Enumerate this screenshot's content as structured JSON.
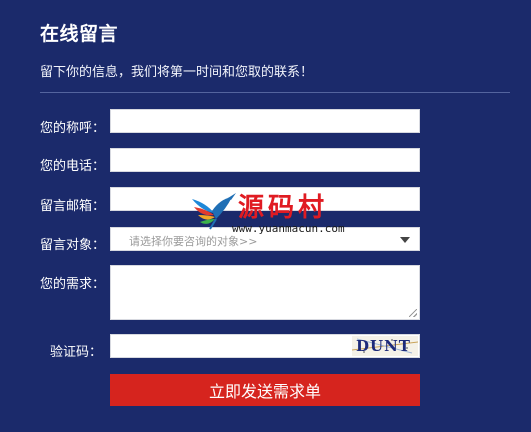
{
  "form": {
    "title": "在线留言",
    "subtitle": "留下你的信息，我们将第一时间和您取的联系！",
    "fields": {
      "name_label": "您的称呼：",
      "phone_label": "您的电话：",
      "email_label": "留言邮箱：",
      "target_label": "留言对象：",
      "target_placeholder": "请选择你要咨询的对象>>",
      "need_label": "您的需求：",
      "captcha_label": "验证码：",
      "captcha_text": "DUNT"
    },
    "submit_label": "立即发送需求单"
  },
  "watermark": {
    "text": "源码村",
    "url": "www.yuanmacun.com"
  },
  "colors": {
    "background": "#1b2a6b",
    "button": "#d6241e",
    "watermark": "#e01b22"
  }
}
